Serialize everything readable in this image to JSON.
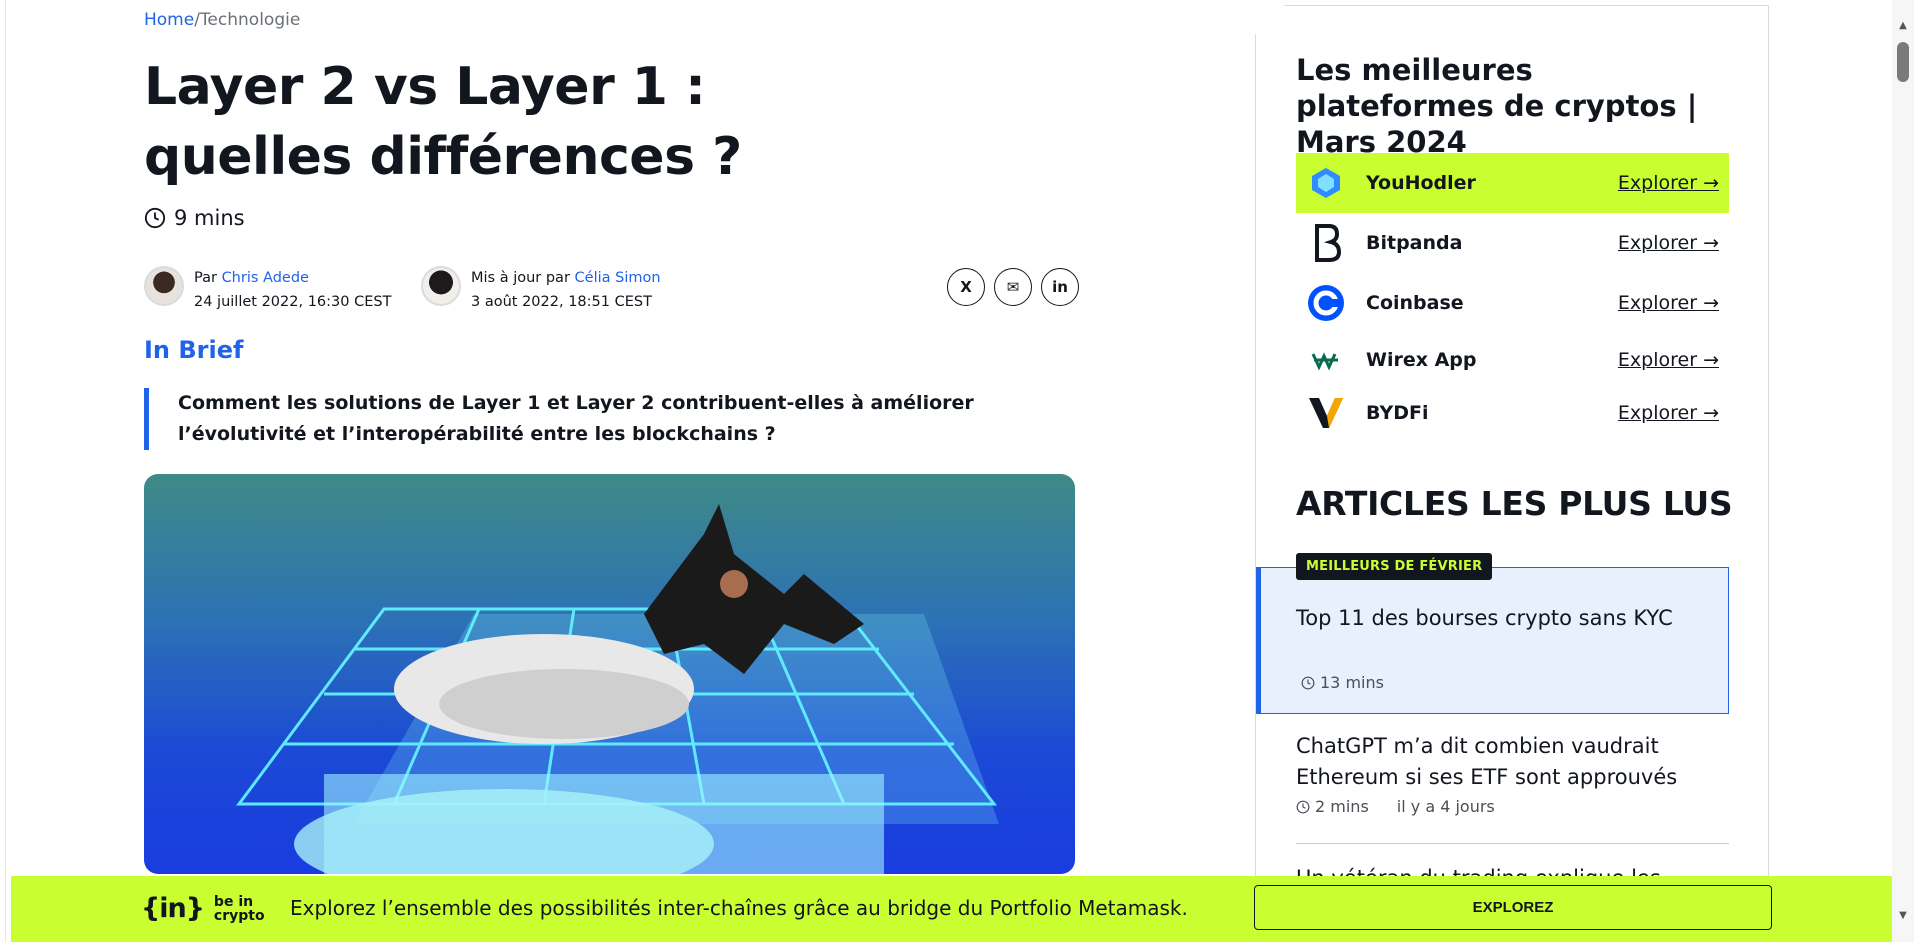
{
  "breadcrumb": {
    "home": "Home",
    "separator": "/",
    "current": "Technologie"
  },
  "article": {
    "title": "Layer 2 vs Layer 1 : quelles différences ?",
    "read_time": "9 mins",
    "author": {
      "prefix": "Par",
      "name": "Chris Adede",
      "date": "24 juillet 2022, 16:30 CEST"
    },
    "updater": {
      "prefix": "Mis à jour par",
      "name": "Célia Simon",
      "date": "3 août 2022, 18:51 CEST"
    },
    "share": {
      "x": "X",
      "email": "✉",
      "linkedin": "in"
    },
    "in_brief_label": "In Brief",
    "summary": "Comment les solutions de Layer 1 et Layer 2 contribuent-elles à améliorer l’évolutivité et l’interopérabilité entre les blockchains ?"
  },
  "sidebar": {
    "title": "Les meilleures plateformes de cryptos | Mars 2024",
    "platforms": [
      {
        "name": "YouHodler",
        "cta": "Explorer →",
        "logo": "youhodler-icon"
      },
      {
        "name": "Bitpanda",
        "cta": "Explorer →",
        "logo": "bitpanda-icon"
      },
      {
        "name": "Coinbase",
        "cta": "Explorer →",
        "logo": "coinbase-icon"
      },
      {
        "name": "Wirex App",
        "cta": "Explorer →",
        "logo": "wirex-icon"
      },
      {
        "name": "BYDFi",
        "cta": "Explorer →",
        "logo": "bydfi-icon"
      }
    ],
    "most_read_heading": "ARTICLES LES PLUS LUS",
    "featured": {
      "badge": "MEILLEURS DE FÉVRIER",
      "title": "Top 11 des bourses crypto sans KYC",
      "time": "13 mins"
    },
    "articles": [
      {
        "title": "ChatGPT m’a dit combien vaudrait Ethereum si ses ETF sont approuvés",
        "time": "2 mins",
        "age": "il y a 4 jours"
      },
      {
        "title": "Un vétéran du trading explique les"
      }
    ]
  },
  "banner": {
    "logo_mark": "{in}",
    "logo_word_1": "be in",
    "logo_word_2": "crypto",
    "text": "Explorez l’ensemble des possibilités inter-chaînes grâce au bridge du Portfolio Metamask.",
    "button": "EXPLOREZ"
  },
  "colors": {
    "accent": "#2163e8",
    "lime": "#c9ff30",
    "ink": "#12161e"
  }
}
